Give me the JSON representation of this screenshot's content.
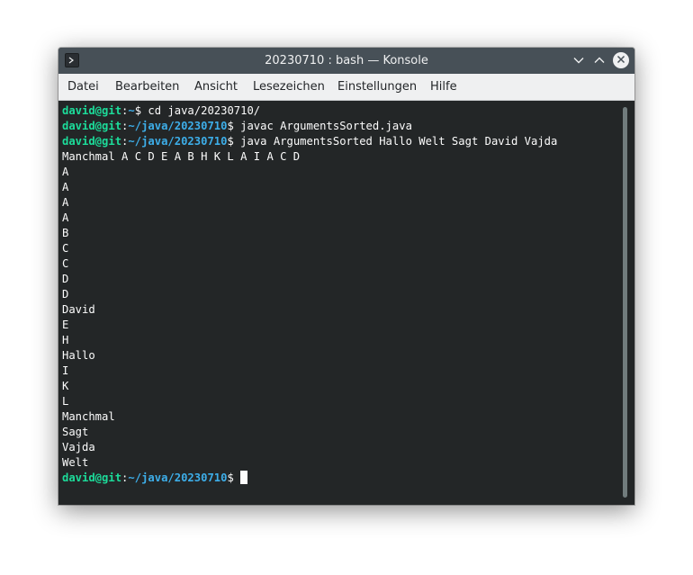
{
  "window": {
    "title": "20230710 : bash — Konsole",
    "icons": {
      "app": "terminal-app-icon",
      "minimize": "chevron-down-icon",
      "maximize": "chevron-up-icon",
      "close": "close-icon"
    }
  },
  "menu": [
    "Datei",
    "Bearbeiten",
    "Ansicht",
    "Lesezeichen",
    "Einstellungen",
    "Hilfe"
  ],
  "terminal": {
    "prompts": [
      {
        "user": "david@git",
        "sep": ":",
        "path": "~",
        "cmd": "$ cd java/20230710/"
      },
      {
        "user": "david@git",
        "sep": ":",
        "path": "~/java/20230710",
        "cmd": "$ javac ArgumentsSorted.java"
      },
      {
        "user": "david@git",
        "sep": ":",
        "path": "~/java/20230710",
        "cmd": "$ java ArgumentsSorted Hallo Welt Sagt David Vajda"
      }
    ],
    "output": [
      "Manchmal A C D E A B H K L A I A C D",
      "A",
      "A",
      "A",
      "A",
      "B",
      "C",
      "C",
      "D",
      "D",
      "David",
      "E",
      "H",
      "Hallo",
      "I",
      "K",
      "L",
      "Manchmal",
      "Sagt",
      "Vajda",
      "Welt"
    ],
    "final_prompt": {
      "user": "david@git",
      "sep": ":",
      "path": "~/java/20230710",
      "cmd": "$"
    }
  },
  "colors": {
    "user": "#1cdc9a",
    "path": "#3daee9",
    "background": "#232627",
    "titlebar": "#475057",
    "menubar": "#eff0f1"
  }
}
